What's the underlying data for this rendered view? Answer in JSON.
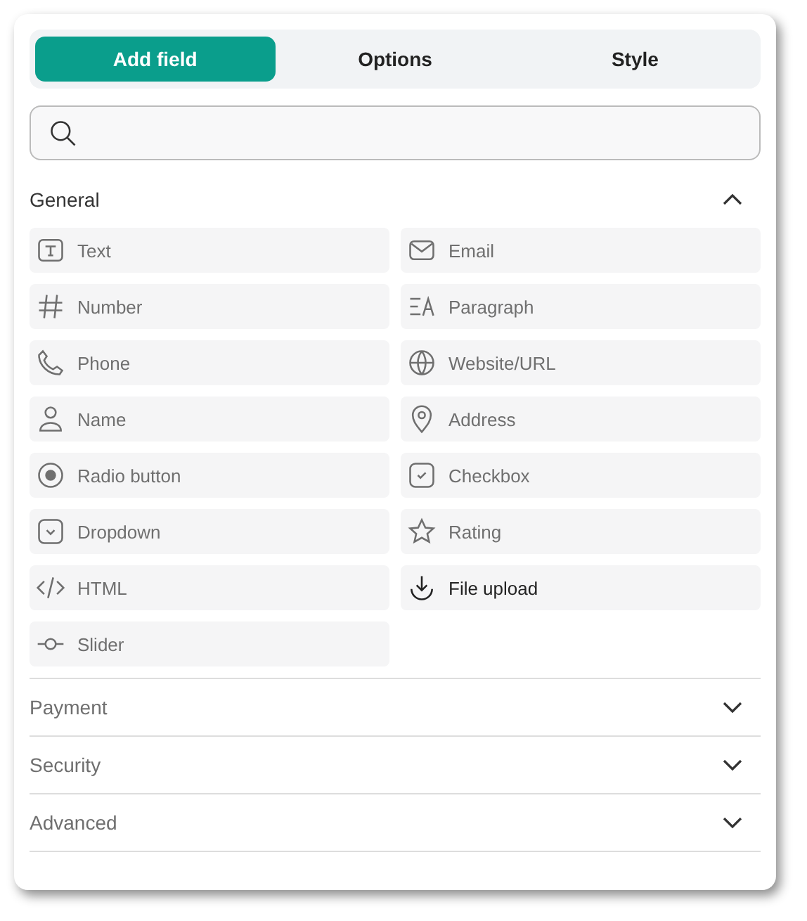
{
  "tabs": [
    {
      "label": "Add field",
      "selected": true
    },
    {
      "label": "Options",
      "selected": false
    },
    {
      "label": "Style",
      "selected": false
    }
  ],
  "sections": [
    {
      "title": "General",
      "expanded": true,
      "dimmed": false,
      "fields": [
        {
          "kind": "text",
          "label": "Text",
          "dimmed": true
        },
        {
          "kind": "email",
          "label": "Email",
          "dimmed": true
        },
        {
          "kind": "number",
          "label": "Number",
          "dimmed": true
        },
        {
          "kind": "paragraph",
          "label": "Paragraph",
          "dimmed": true
        },
        {
          "kind": "phone",
          "label": "Phone",
          "dimmed": true
        },
        {
          "kind": "url",
          "label": "Website/URL",
          "dimmed": true
        },
        {
          "kind": "name",
          "label": "Name",
          "dimmed": true
        },
        {
          "kind": "address",
          "label": "Address",
          "dimmed": true
        },
        {
          "kind": "radio",
          "label": "Radio button",
          "dimmed": true
        },
        {
          "kind": "checkbox",
          "label": "Checkbox",
          "dimmed": true
        },
        {
          "kind": "dropdown",
          "label": "Dropdown",
          "dimmed": true
        },
        {
          "kind": "rating",
          "label": "Rating",
          "dimmed": true
        },
        {
          "kind": "html",
          "label": "HTML",
          "dimmed": true
        },
        {
          "kind": "upload",
          "label": "File upload",
          "dimmed": false
        },
        {
          "kind": "slider",
          "label": "Slider",
          "dimmed": true
        }
      ]
    },
    {
      "title": "Payment",
      "expanded": false,
      "dimmed": true
    },
    {
      "title": "Security",
      "expanded": false,
      "dimmed": true
    },
    {
      "title": "Advanced",
      "expanded": false,
      "dimmed": true
    }
  ]
}
